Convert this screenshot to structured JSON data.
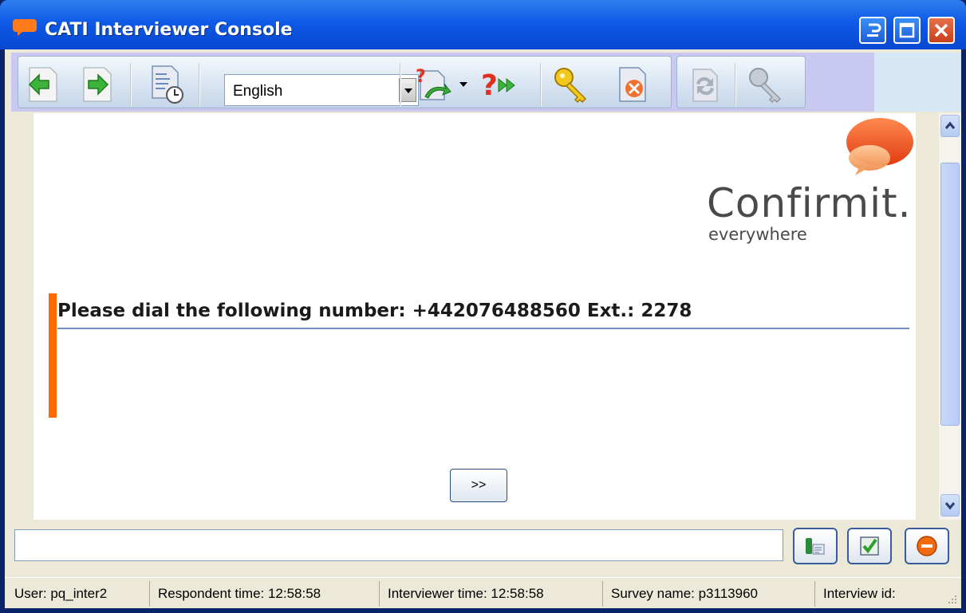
{
  "window": {
    "title": "CATI Interviewer Console"
  },
  "toolbar": {
    "buttons": [
      {
        "name": "back",
        "icon": "green-left-arrow-icon"
      },
      {
        "name": "forward",
        "icon": "green-right-arrow-icon"
      },
      {
        "name": "history",
        "icon": "document-clock-icon"
      },
      {
        "name": "return-call",
        "icon": "question-phone-return-icon"
      },
      {
        "name": "skip-question",
        "icon": "question-fast-forward-icon"
      },
      {
        "name": "key",
        "icon": "key-icon"
      },
      {
        "name": "cancel-document",
        "icon": "document-delete-icon"
      },
      {
        "name": "refresh",
        "icon": "refresh-disabled-icon"
      },
      {
        "name": "key-disabled",
        "icon": "key-disabled-icon"
      }
    ],
    "language": "English"
  },
  "content": {
    "brand": "Confirmit.",
    "brand_tagline": "everywhere",
    "question": "Please dial the following number: +442076488560 Ext.: 2278",
    "next_label": ">>"
  },
  "bottom": {
    "input_value": "",
    "buttons": [
      {
        "name": "phone-book",
        "icon": "phone-card-icon"
      },
      {
        "name": "confirm",
        "icon": "checkmark-icon"
      },
      {
        "name": "stop",
        "icon": "stop-icon"
      }
    ]
  },
  "status": {
    "user": "User:  pq_inter2",
    "respondent_time": "Respondent time:  12:58:58",
    "interviewer_time": "Interviewer time:  12:58:58",
    "survey_name": "Survey name:  p3113960",
    "interview_id": "Interview id:"
  },
  "colors": {
    "title_blue": "#0e5ae6",
    "accent_orange": "#ff6a00",
    "frame": "#ece9d8"
  }
}
